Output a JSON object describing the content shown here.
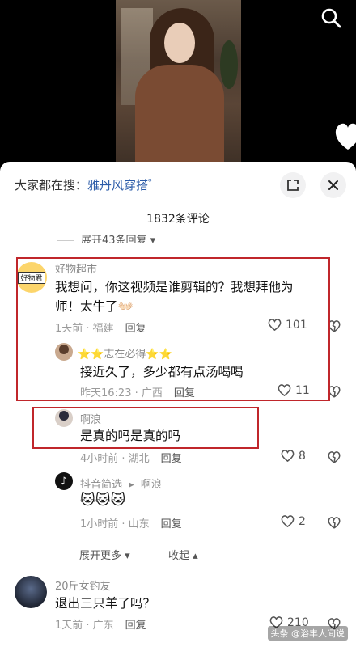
{
  "search_bar": {
    "prefix": "大家都在搜：",
    "term": "雅丹风穿搭",
    "term_suffix": "ᵠ"
  },
  "comment_count": "1832条评论",
  "expand_top": "展开43条回复",
  "comments": {
    "c1": {
      "avatar_text": "好物君",
      "user": "好物超市",
      "text": "我想问，你这视频是谁剪辑的？我想拜他为师！太牛了👐🏻",
      "time": "1天前 · 福建",
      "reply": "回复",
      "likes": "101"
    },
    "r1": {
      "user": "⭐⭐志在必得⭐⭐",
      "text": "接近久了，多少都有点汤喝喝",
      "time": "昨天16:23 · 广西",
      "reply": "回复",
      "likes": "11"
    },
    "r2": {
      "user": "啊浪",
      "text": "是真的吗是真的吗",
      "time": "4小时前 · 湖北",
      "reply": "回复",
      "likes": "8"
    },
    "r3": {
      "user": "抖音简选",
      "user_to": "啊浪",
      "text": "🐱🐱🐱",
      "time": "1小时前 · 山东",
      "reply": "回复",
      "likes": "2"
    },
    "c2": {
      "user": "20斤女钓友",
      "text": "退出三只羊了吗？",
      "time": "1天前 · 广东",
      "reply": "回复",
      "likes": "210"
    }
  },
  "expand_more": "展开更多",
  "collapse": "收起",
  "watermark": "头条 @浴丰人间说",
  "colors": {
    "accent": "#2b5ba8",
    "highlight_box": "#c0262b"
  }
}
